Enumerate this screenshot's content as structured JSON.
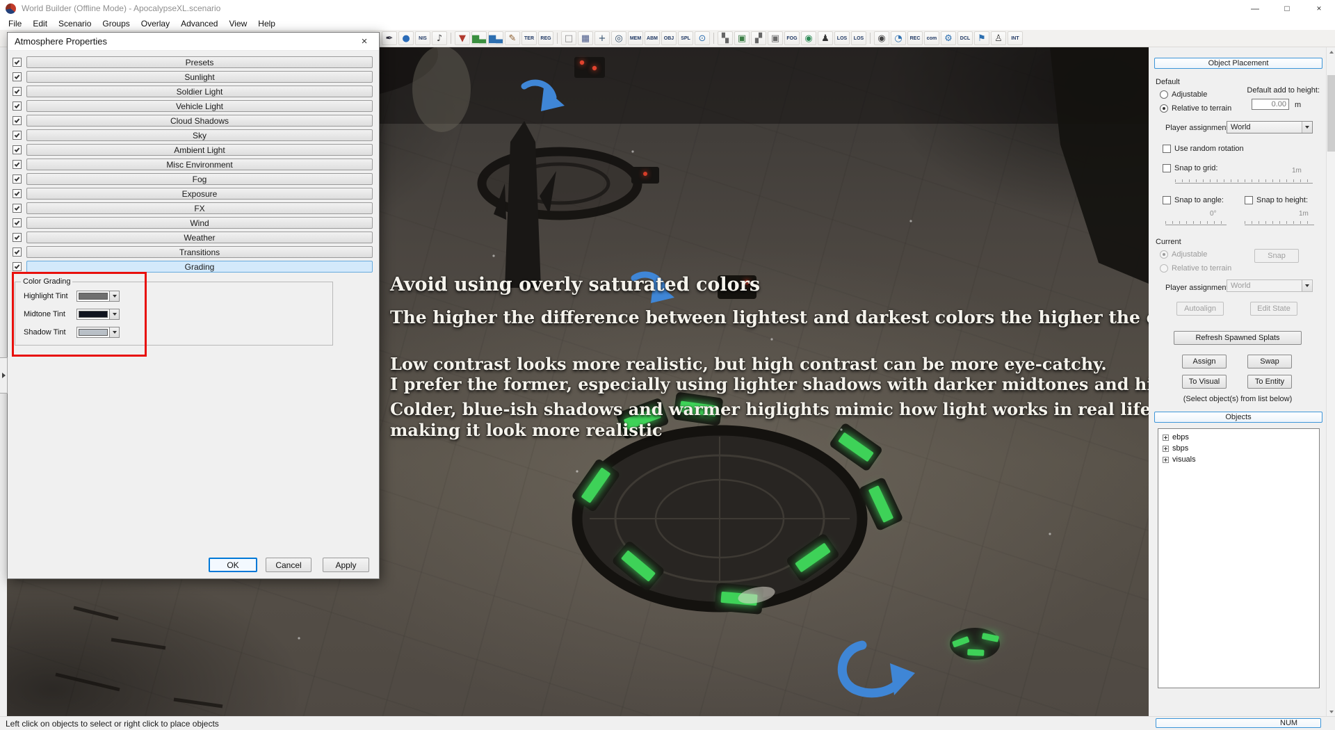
{
  "colors": {
    "arrow_blue": "#3f86d6",
    "glow_green": "#3ed258",
    "annotation_red": "#e8100c",
    "selection_blue": "#0078d7",
    "panel_header_blue": "#3d95d8"
  },
  "window": {
    "title": "World Builder (Offline Mode) - ApocalypseXL.scenario",
    "minimize_icon": "—",
    "maximize_icon": "□",
    "close_icon": "×"
  },
  "menu": {
    "items": [
      "File",
      "Edit",
      "Scenario",
      "Groups",
      "Overlay",
      "Advanced",
      "View",
      "Help"
    ]
  },
  "toolbar": {
    "icons": [
      {
        "name": "pen-tool-icon",
        "kind": "glyph",
        "text": "✒",
        "color": "#2b2b3a",
        "inter": "true"
      },
      {
        "name": "water-paint-icon",
        "kind": "glyph",
        "text": "●",
        "color": "#2b6cb8",
        "inter": "true"
      },
      {
        "name": "nis-icon",
        "kind": "text",
        "text": "NIS",
        "color": "#1f3864",
        "inter": "true"
      },
      {
        "name": "nis-marks-icon",
        "kind": "glyph",
        "text": "♪",
        "color": "#444444",
        "inter": "true"
      },
      {
        "name": "toolbar-separator",
        "kind": "sep",
        "text": "",
        "color": "",
        "inter": "false"
      },
      {
        "name": "paint-drop-icon",
        "kind": "glyph",
        "text": "▼",
        "color": "#b03a2e",
        "inter": "true"
      },
      {
        "name": "green-histogram-icon",
        "kind": "glyph",
        "text": "▆▃",
        "color": "#3a8f3f",
        "inter": "true"
      },
      {
        "name": "blue-histogram-icon",
        "kind": "glyph",
        "text": "▆▃",
        "color": "#2d6fb0",
        "inter": "true"
      },
      {
        "name": "pencil-icon",
        "kind": "glyph",
        "text": "✎",
        "color": "#8a5a2b",
        "inter": "true"
      },
      {
        "name": "ter-icon",
        "kind": "text",
        "text": "TER",
        "color": "#1f3864",
        "inter": "true"
      },
      {
        "name": "reg-icon",
        "kind": "text",
        "text": "REG",
        "color": "#1f3864",
        "inter": "true"
      },
      {
        "name": "toolbar-separator",
        "kind": "sep",
        "text": "",
        "color": "",
        "inter": "false"
      },
      {
        "name": "blank-tile-icon",
        "kind": "glyph",
        "text": "□",
        "color": "#8a8a8a",
        "inter": "true"
      },
      {
        "name": "grid-tile-icon",
        "kind": "glyph",
        "text": "▦",
        "color": "#4a5a8a",
        "inter": "true"
      },
      {
        "name": "crosshair-icon",
        "kind": "glyph",
        "text": "+",
        "color": "#33506e",
        "inter": "true"
      },
      {
        "name": "marker-points-icon",
        "kind": "glyph",
        "text": "◎",
        "color": "#33506e",
        "inter": "true"
      },
      {
        "name": "mem-brf-icon",
        "kind": "text",
        "text": "MEM",
        "color": "#1f3864",
        "inter": "true"
      },
      {
        "name": "abm-icon",
        "kind": "text",
        "text": "ABM",
        "color": "#1f3864",
        "inter": "true"
      },
      {
        "name": "obj-icon",
        "kind": "text",
        "text": "OBJ",
        "color": "#1f3864",
        "inter": "true"
      },
      {
        "name": "spl-icon",
        "kind": "text",
        "text": "SPL",
        "color": "#1f3864",
        "inter": "true"
      },
      {
        "name": "magnifier-icon",
        "kind": "glyph",
        "text": "⊙",
        "color": "#2d6fb0",
        "inter": "true"
      },
      {
        "name": "toolbar-separator",
        "kind": "sep",
        "text": "",
        "color": "",
        "inter": "false"
      },
      {
        "name": "dither-pattern-icon",
        "kind": "glyph",
        "text": "▚",
        "color": "#666666",
        "inter": "true"
      },
      {
        "name": "splat-image-icon",
        "kind": "glyph",
        "text": "▣",
        "color": "#3a7d44",
        "inter": "true"
      },
      {
        "name": "dither-pattern2-icon",
        "kind": "glyph",
        "text": "▞",
        "color": "#666666",
        "inter": "true"
      },
      {
        "name": "decal-image-icon",
        "kind": "glyph",
        "text": "▣",
        "color": "#6a6a6a",
        "inter": "true"
      },
      {
        "name": "fog-icon",
        "kind": "text",
        "text": "FOG",
        "color": "#1f3864",
        "inter": "true"
      },
      {
        "name": "world-globe-icon",
        "kind": "glyph",
        "text": "◉",
        "color": "#2e8b57",
        "inter": "true"
      },
      {
        "name": "squad-icon",
        "kind": "glyph",
        "text": "♟",
        "color": "#333333",
        "inter": "true"
      },
      {
        "name": "los-icon",
        "kind": "text",
        "text": "LOS",
        "color": "#1f3864",
        "inter": "true"
      },
      {
        "name": "los-alt-icon",
        "kind": "text",
        "text": "LOS",
        "color": "#1f3864",
        "inter": "true"
      },
      {
        "name": "toolbar-separator",
        "kind": "sep",
        "text": "",
        "color": "",
        "inter": "false"
      },
      {
        "name": "eye-icon",
        "kind": "glyph",
        "text": "◉",
        "color": "#444444",
        "inter": "true"
      },
      {
        "name": "sector-icon",
        "kind": "glyph",
        "text": "◔",
        "color": "#2d6fb0",
        "inter": "true"
      },
      {
        "name": "rec-icon",
        "kind": "text",
        "text": "REC",
        "color": "#1f3864",
        "inter": "true"
      },
      {
        "name": "com-icon",
        "kind": "text",
        "text": "com",
        "color": "#1f3864",
        "inter": "true"
      },
      {
        "name": "gear-icon",
        "kind": "glyph",
        "text": "⚙",
        "color": "#2d6fb0",
        "inter": "true"
      },
      {
        "name": "dcl-icon",
        "kind": "text",
        "text": "DCL",
        "color": "#1f3864",
        "inter": "true"
      },
      {
        "name": "flag-icon",
        "kind": "glyph",
        "text": "⚑",
        "color": "#2d6fb0",
        "inter": "true"
      },
      {
        "name": "walker-pawn-icon",
        "kind": "glyph",
        "text": "♙",
        "color": "#444444",
        "inter": "true"
      },
      {
        "name": "int-icon",
        "kind": "text",
        "text": "INT",
        "color": "#1f3864",
        "inter": "true"
      }
    ]
  },
  "dialog": {
    "title": "Atmosphere Properties",
    "close_icon": "×",
    "sections": [
      {
        "label": "Presets",
        "state": ""
      },
      {
        "label": "Sunlight",
        "state": ""
      },
      {
        "label": "Soldier Light",
        "state": ""
      },
      {
        "label": "Vehicle Light",
        "state": ""
      },
      {
        "label": "Cloud Shadows",
        "state": ""
      },
      {
        "label": "Sky",
        "state": ""
      },
      {
        "label": "Ambient Light",
        "state": ""
      },
      {
        "label": "Misc Environment",
        "state": ""
      },
      {
        "label": "Fog",
        "state": ""
      },
      {
        "label": "Exposure",
        "state": ""
      },
      {
        "label": "FX",
        "state": ""
      },
      {
        "label": "Wind",
        "state": ""
      },
      {
        "label": "Weather",
        "state": ""
      },
      {
        "label": "Transitions",
        "state": ""
      },
      {
        "label": "Grading",
        "state": "selected"
      }
    ],
    "color_grading": {
      "group_label": "Color Grading",
      "rows": [
        {
          "label": "Highlight Tint",
          "swatch": "#6f6f6f"
        },
        {
          "label": "Midtone Tint",
          "swatch": "#10141f"
        },
        {
          "label": "Shadow Tint",
          "swatch": "#b9c0c7"
        }
      ]
    },
    "buttons": {
      "ok": "OK",
      "cancel": "Cancel",
      "apply": "Apply"
    }
  },
  "viewport": {
    "overlay_lines": [
      "Avoid using overly saturated colors",
      "The higher the difference between lightest and darkest colors the higher the contrast",
      "Low contrast looks more realistic, but high contrast can be more eye-catchy.",
      "I prefer the former, especially using lighter shadows with darker midtones and highlights",
      "Colder, blue-ish shadows and warmer higlights mimic how light works in real life",
      "making it look more realistic"
    ]
  },
  "right_panel": {
    "placement_header": "Object Placement",
    "default_group": {
      "label": "Default",
      "adjustable": "Adjustable",
      "relative": "Relative to terrain",
      "add_height_label": "Default add to height:",
      "add_height_value": "0.00",
      "add_height_unit": "m",
      "player_assignment_label": "Player assignment:",
      "player_assignment_value": "World",
      "random_rotation": "Use random rotation",
      "snap_grid": "Snap to grid:",
      "snap_grid_value": "1m",
      "snap_angle": "Snap to angle:",
      "snap_height": "Snap to height:",
      "angle_value": "0°",
      "height_value": "1m"
    },
    "current_group": {
      "label": "Current",
      "adjustable": "Adjustable",
      "relative": "Relative to terrain",
      "snap_button": "Snap",
      "player_assignment_label": "Player assignment:",
      "player_assignment_value": "World",
      "autoalign_button": "Autoalign",
      "edit_state_button": "Edit State"
    },
    "refresh_splats_button": "Refresh Spawned Splats",
    "assign_button": "Assign",
    "swap_button": "Swap",
    "to_visual_button": "To Visual",
    "to_entity_button": "To Entity",
    "select_hint": "(Select object(s) from list below)",
    "objects_header": "Objects",
    "objects_tree": [
      {
        "label": "ebps"
      },
      {
        "label": "sbps"
      },
      {
        "label": "visuals"
      }
    ]
  },
  "status_bar": {
    "message": "Left click on objects to select or right click to place objects",
    "num": "NUM"
  }
}
